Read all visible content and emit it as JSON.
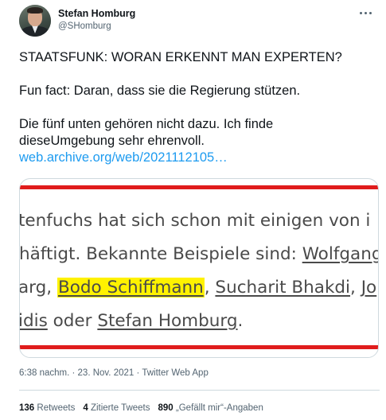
{
  "author": {
    "name": "Stefan Homburg",
    "handle": "@SHomburg"
  },
  "tweet": {
    "line1": "STAATSFUNK: WORAN ERKENNT MAN EXPERTEN?",
    "line2": "Fun fact: Daran, dass sie die Regierung stützen.",
    "line3a": "Die fünf unten gehören nicht dazu. Ich finde",
    "line3b": "dieseUmgebung sehr ehrenvoll.",
    "link": "web.archive.org/web/2021112105…"
  },
  "media": {
    "l1": "tenfuchs hat sich schon mit einigen von i",
    "l2_pre": "häftigt. Bekannte Beispiele sind: ",
    "l2_name": "Wolfgang",
    "l3_pre": "arg, ",
    "l3_name1": "Bodo Schiffmann",
    "l3_sep": ", ",
    "l3_name2": "Sucharit Bhakdi",
    "l3_sep2": ", ",
    "l3_name3": "Jo",
    "l4_pre": "idis",
    "l4_mid": " oder ",
    "l4_name": "Stefan Homburg",
    "l4_end": ".",
    "line_color": "#e01c1c",
    "highlight_color": "#fff200"
  },
  "meta": {
    "time": "6:38 nachm.",
    "sep1": " · ",
    "date": "23. Nov. 2021",
    "sep2": " · ",
    "source": "Twitter Web App"
  },
  "stats": {
    "retweets_count": "136",
    "retweets_label": "Retweets",
    "quotes_count": "4",
    "quotes_label": "Zitierte Tweets",
    "likes_count": "890",
    "likes_label": "„Gefällt mir“-Angaben"
  },
  "icons": {
    "more": "more-horizontal-icon"
  }
}
